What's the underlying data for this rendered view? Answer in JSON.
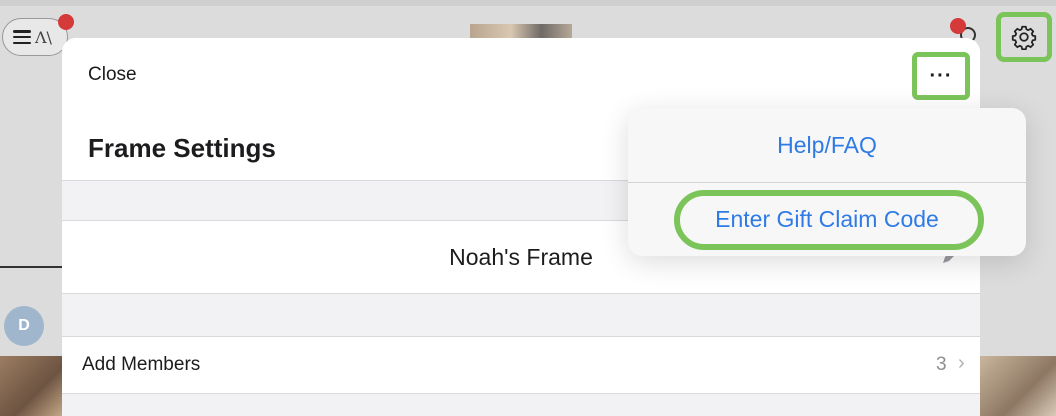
{
  "background": {
    "avatar_initial": "D",
    "logo_text": "Λ\\"
  },
  "sheet": {
    "close_label": "Close",
    "more_label": "···",
    "title": "Frame Settings",
    "frame_name": "Noah's Frame",
    "add_members_label": "Add Members",
    "members_count": "3",
    "chevron": "›"
  },
  "popover": {
    "items": [
      {
        "label": "Help/FAQ"
      },
      {
        "label": "Enter Gift Claim Code"
      }
    ]
  },
  "colors": {
    "accent_link": "#2f7be5",
    "highlight": "#7bc45a",
    "notification": "#d53a3a"
  },
  "icons": [
    "menu-icon",
    "gear-icon",
    "more-icon",
    "pencil-icon",
    "chevron-right-icon",
    "search-icon"
  ]
}
